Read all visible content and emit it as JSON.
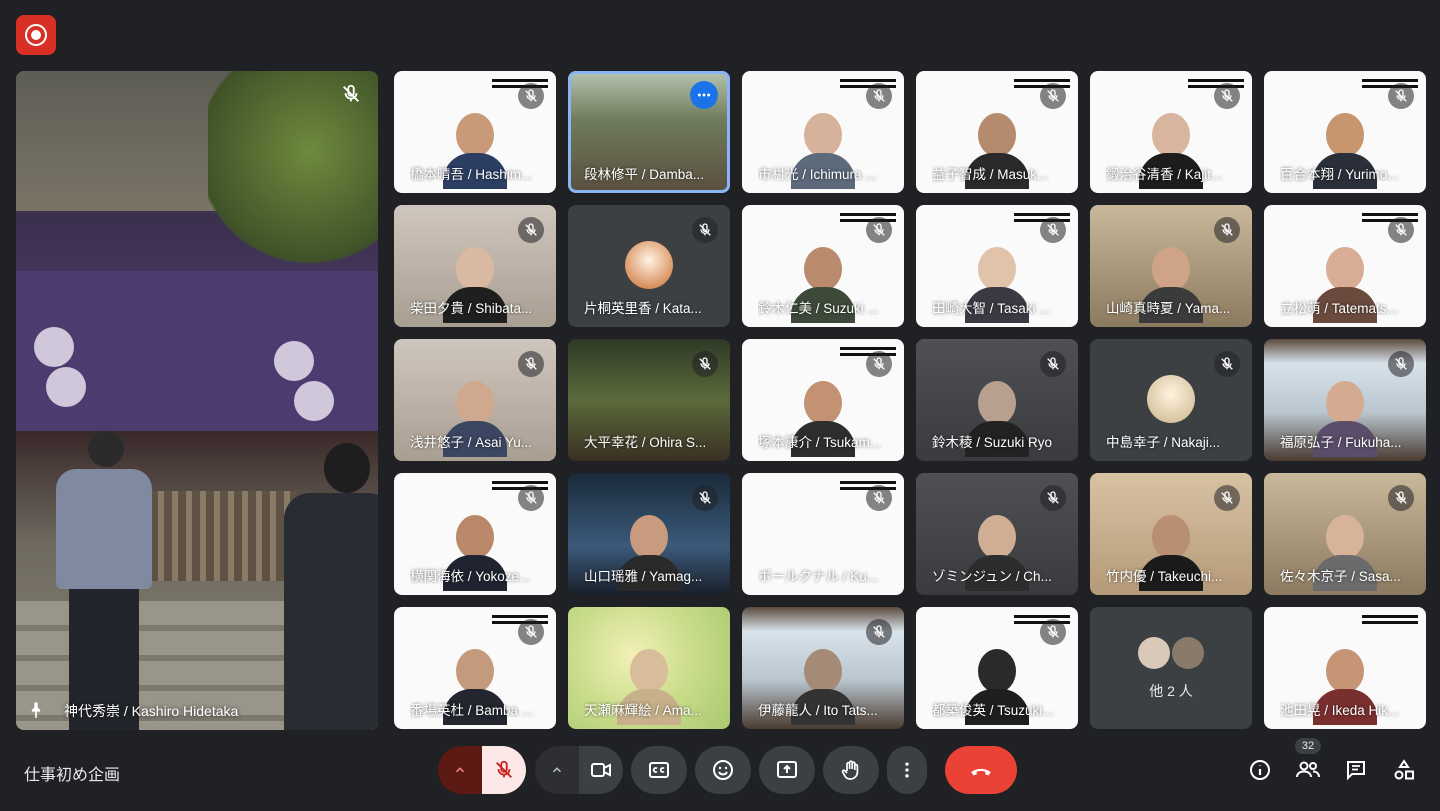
{
  "meeting": {
    "title": "仕事初め企画"
  },
  "pinned": {
    "name": "神代秀崇 / Kashiro Hidetaka"
  },
  "participants_count": "32",
  "others_label": "他 2 人",
  "tiles": [
    {
      "name": "橋本晴吾 / Hashim...",
      "kind": "slide",
      "skin": "#c89a78",
      "shirt": "#2c3f63"
    },
    {
      "name": "段林修平 / Damba...",
      "kind": "outdoor",
      "active": true
    },
    {
      "name": "市村光 / Ichimura ...",
      "kind": "slide",
      "skin": "#d6b29a",
      "shirt": "#5c6a7c"
    },
    {
      "name": "益子智成 / Masuk...",
      "kind": "slide",
      "skin": "#b68a6d",
      "shirt": "#2a2a2a"
    },
    {
      "name": "鍛治谷清香 / Kajit...",
      "kind": "slide",
      "skin": "#d8b59e",
      "shirt": "#1d1d1d"
    },
    {
      "name": "百合本翔 / Yurimo...",
      "kind": "slide",
      "skin": "#c7956e",
      "shirt": "#2b2f3a"
    },
    {
      "name": "柴田夕貴 / Shibata...",
      "kind": "room",
      "skin": "#d9b9a2",
      "shirt": "#1f1f1f"
    },
    {
      "name": "片桐英里香 / Kata...",
      "kind": "avatar",
      "av": "#c96a2f"
    },
    {
      "name": "鈴木仁美 / Suzuki ...",
      "kind": "slide",
      "skin": "#b98b6c",
      "shirt": "#3d4a3a"
    },
    {
      "name": "田崎大智 / Tasaki ...",
      "kind": "slide",
      "skin": "#e0c3a9",
      "shirt": "#3a3a44"
    },
    {
      "name": "山崎真時夏 / Yama...",
      "kind": "cafe",
      "skin": "#cfa386",
      "shirt": "#3b3b3b"
    },
    {
      "name": "立松萌 / Tatemats...",
      "kind": "slide",
      "skin": "#d9ad94",
      "shirt": "#6b4a3e"
    },
    {
      "name": "浅井悠子 / Asai Yu...",
      "kind": "room",
      "skin": "#d0a88e",
      "shirt": "#3b4660"
    },
    {
      "name": "大平幸花 / Ohira S...",
      "kind": "garden"
    },
    {
      "name": "塚本康介 / Tsukam...",
      "kind": "slide",
      "skin": "#c29273",
      "shirt": "#2e2e2e"
    },
    {
      "name": "鈴木稜 / Suzuki Ryo",
      "kind": "gray",
      "skin": "#b8a090",
      "shirt": "#222"
    },
    {
      "name": "中島幸子 / Nakaji...",
      "kind": "avatar",
      "av": "#c9b48a"
    },
    {
      "name": "福原弘子 / Fukuha...",
      "kind": "cabin",
      "skin": "#d4ab90",
      "shirt": "#5b4d6a"
    },
    {
      "name": "横関海依 / Yokoze...",
      "kind": "slide",
      "skin": "#b88868",
      "shirt": "#1f2430"
    },
    {
      "name": "山口瑶雅 / Yamag...",
      "kind": "space",
      "skin": "#c89a7e",
      "shirt": "#2a2a2a"
    },
    {
      "name": "ポールクナル / Ku...",
      "kind": "slide-empty"
    },
    {
      "name": "ゾミンジュン / Ch...",
      "kind": "gray",
      "skin": "#cfae94",
      "shirt": "#2d2d2d"
    },
    {
      "name": "竹内優 / Takeuchi...",
      "kind": "wood",
      "skin": "#b88f72",
      "shirt": "#1b1b1b"
    },
    {
      "name": "佐々木京子 / Sasa...",
      "kind": "cafe",
      "skin": "#d7b39a",
      "shirt": "#6b6b6b"
    },
    {
      "name": "番場英杜 / Bamba ...",
      "kind": "slide",
      "skin": "#c39a7c",
      "shirt": "#23262e"
    },
    {
      "name": "天瀬麻輝絵 / Ama...",
      "kind": "blur",
      "skin": "#d8bd9a",
      "shirt": "#c7b08a"
    },
    {
      "name": "伊藤龍人 / Ito Tats...",
      "kind": "cabin",
      "skin": "#a58a78",
      "shirt": "#333"
    },
    {
      "name": "都築俊英 / Tsuzuki...",
      "kind": "slide",
      "skin": "#2a2a2a",
      "shirt": "#1f1f1f"
    },
    {
      "name": "",
      "kind": "others"
    },
    {
      "name": "池田晃 / Ikeda Hik...",
      "kind": "slide-pres",
      "skin": "#c69576",
      "shirt": "#7a2f2f"
    }
  ]
}
